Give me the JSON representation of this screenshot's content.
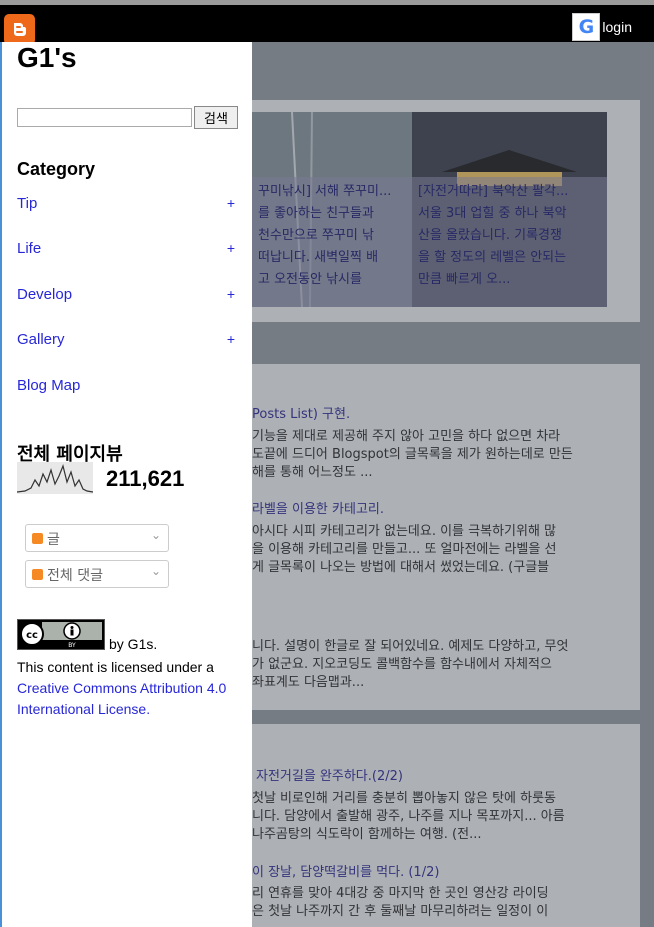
{
  "topbar": {
    "login_label": "login"
  },
  "sidebar": {
    "blog_title": "G1's",
    "search": {
      "placeholder": "",
      "button_label": "검색"
    },
    "category_title": "Category",
    "categories": [
      {
        "label": "Tip",
        "expand": "+"
      },
      {
        "label": "Life",
        "expand": "+"
      },
      {
        "label": "Develop",
        "expand": "+"
      },
      {
        "label": "Gallery",
        "expand": "+"
      },
      {
        "label": "Blog Map",
        "expand": ""
      }
    ],
    "pageviews": {
      "title": "전체 페이지뷰",
      "count": "211,621"
    },
    "feeds": [
      {
        "label": "글"
      },
      {
        "label": "전체 댓글"
      }
    ],
    "license": {
      "by_text": "by G1s.",
      "text": "This content is licensed under a",
      "link_text": "Creative Commons Attribution 4.0 International License."
    }
  },
  "background": {
    "thumbs": [
      {
        "lines": [
          "꾸미낚시] 서해 쭈꾸미...",
          "를 좋아하는 친구들과",
          "천수만으로 쭈꾸미 낚",
          "떠납니다. 새벽일찍 배",
          "고 오전동안 낚시를"
        ]
      },
      {
        "lines": [
          "[자전거따라] 북악산 팔각...",
          "서울 3대 업힐 중 하나 북악",
          "산을 올랐습니다. 기록경쟁",
          "을 할 정도의 레벨은 안되는",
          "만큼 빠르게 오..."
        ]
      }
    ],
    "posts": [
      {
        "title": "Posts List) 구현.",
        "lines": [
          "기능을 제대로 제공해 주지 않아 고민을 하다 없으면 차라",
          "도끝에 드디어 Blogspot의 글목록을 제가 원하는데로 만든",
          "해를 통해 어느정도 ..."
        ]
      },
      {
        "title": "라벨을 이용한 카테고리.",
        "lines": [
          "아시다 시피 카테고리가 없는데요. 이를 극복하기위해 많",
          "을 이용해 카테고리를 만들고... 또 얼마전에는 라벨을 선",
          "게 글목록이 나오는 방법에 대해서 썼었는데요. (구글블"
        ]
      },
      {
        "title": "",
        "lines": [
          "니다. 설명이 한글로 잘 되어있네요. 예제도 다양하고, 무엇",
          "가 없군요. 지오코딩도 콜백함수를 함수내에서 자체적으",
          "좌표계도 다음맵과..."
        ]
      },
      {
        "title": "자전거길을 완주하다.(2/2)",
        "lines": [
          "첫날 비로인해 거리를 충분히 뽑아놓지 않은 탓에 하룻동",
          "니다. 담양에서 출발해 광주, 나주를 지나 목포까지... 아름",
          "나주곰탕의 식도락이 함께하는 여행. (전..."
        ]
      },
      {
        "title": "이 장날, 담양떡갈비를 먹다. (1/2)",
        "lines": [
          "리 연휴를 맞아 4대강 중 마지막 한 곳인 영산강 라이딩",
          "은 첫날 나주까지 간 후 둘째날 마무리하려는 일정이 이"
        ]
      }
    ]
  },
  "colors": {
    "accent_link": "#2727d8",
    "blogger_orange": "#ee6a1a",
    "sidebar_border": "#4a90d9"
  }
}
